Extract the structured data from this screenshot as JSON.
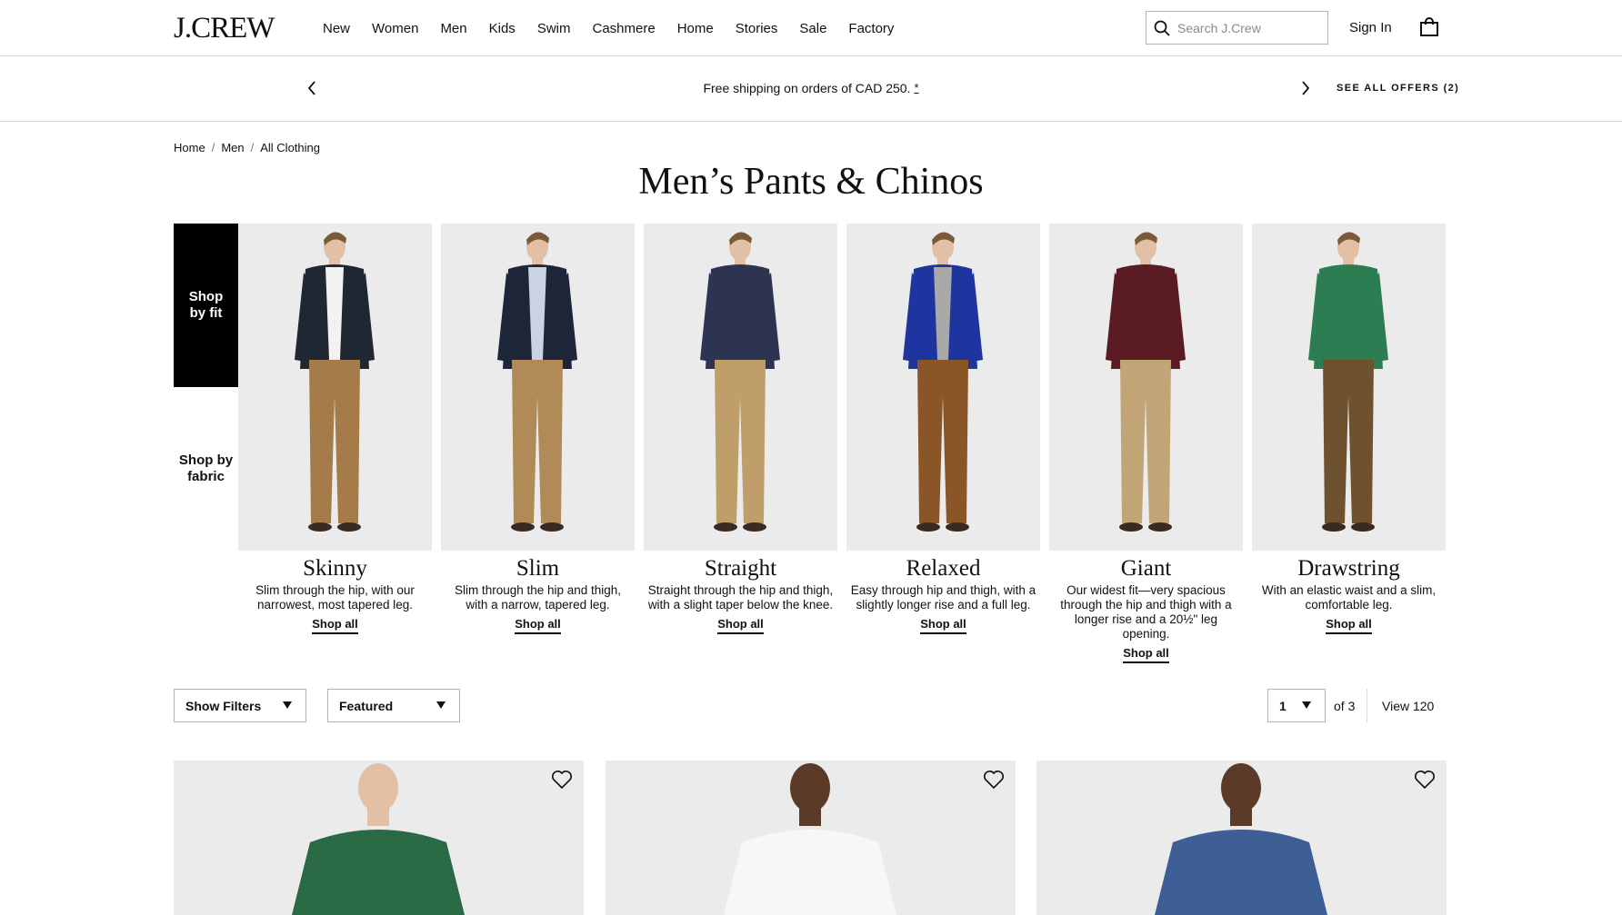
{
  "header": {
    "logo": "J.CREW",
    "nav": [
      "New",
      "Women",
      "Men",
      "Kids",
      "Swim",
      "Cashmere",
      "Home",
      "Stories",
      "Sale",
      "Factory"
    ],
    "search_placeholder": "Search J.Crew",
    "sign_in": "Sign In"
  },
  "promo": {
    "text": "Free shipping on orders of CAD 250.",
    "asterisk": "*",
    "see_offers": "SEE ALL OFFERS (2)"
  },
  "breadcrumb": [
    "Home",
    "Men",
    "All Clothing"
  ],
  "page_title": "Men’s Pants & Chinos",
  "shop_by": {
    "fit": "Shop by fit",
    "fabric": "Shop by fabric"
  },
  "fits": [
    {
      "name": "Skinny",
      "desc": "Slim through the hip, with our narrowest, most tapered leg.",
      "link": "Shop all",
      "shirt": "#1f2733",
      "inner": "#f2f2f2",
      "pants": "#a57b4a"
    },
    {
      "name": "Slim",
      "desc": "Slim through the hip and thigh, with a narrow, tapered leg.",
      "link": "Shop all",
      "shirt": "#1d2538",
      "inner": "#c9d3e3",
      "pants": "#b08a57"
    },
    {
      "name": "Straight",
      "desc": "Straight through the hip and thigh, with a slight taper below the knee.",
      "link": "Shop all",
      "shirt": "#2d3452",
      "inner": "#2d3452",
      "pants": "#bf9e69"
    },
    {
      "name": "Relaxed",
      "desc": "Easy through hip and thigh, with a slightly longer rise and a full leg.",
      "link": "Shop all",
      "shirt": "#1e35a0",
      "inner": "#a9a9a9",
      "pants": "#8a5527"
    },
    {
      "name": "Giant",
      "desc": "Our widest fit—very spacious through the hip and thigh with a longer rise and a 20½\" leg opening.",
      "link": "Shop all",
      "shirt": "#5a1c22",
      "inner": "#5a1c22",
      "pants": "#c2a577"
    },
    {
      "name": "Drawstring",
      "desc": "With an elastic waist and a slim, comfortable leg.",
      "link": "Shop all",
      "shirt": "#2c7d51",
      "inner": "#2c7d51",
      "pants": "#6e5230"
    }
  ],
  "toolbar": {
    "filters": "Show Filters",
    "sort": "Featured",
    "page": "1",
    "of_pages": "of 3",
    "view_all": "View 120"
  },
  "products": [
    {
      "shirt": "#2a6a44"
    },
    {
      "shirt": "#f7f7f7"
    },
    {
      "shirt": "#3e5f96"
    }
  ]
}
